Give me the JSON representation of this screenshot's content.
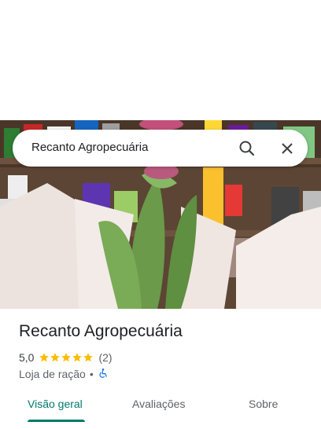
{
  "search": {
    "query": "Recanto Agropecuária"
  },
  "place": {
    "name": "Recanto Agropecuária",
    "rating": "5,0",
    "stars": 5,
    "review_count": "(2)",
    "category": "Loja de ração",
    "separator": "•"
  },
  "tabs": [
    {
      "label": "Visão geral"
    },
    {
      "label": "Avaliações"
    },
    {
      "label": "Sobre"
    }
  ],
  "icons": {
    "search": "search-icon",
    "close": "close-icon",
    "accessibility": "wheelchair-icon",
    "star": "star-icon"
  },
  "colors": {
    "accent": "#00796b",
    "star": "#fbbc04",
    "accessibility": "#1a73e8"
  }
}
